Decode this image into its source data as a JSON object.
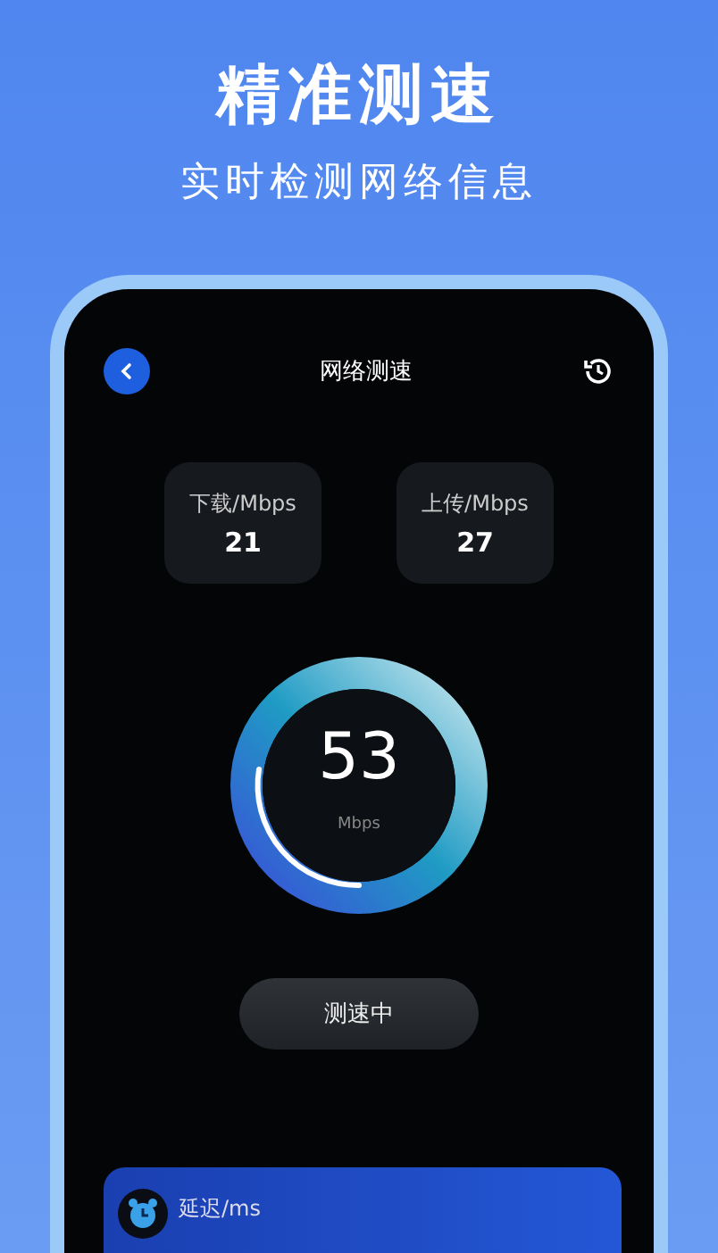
{
  "banner": {
    "title": "精准测速",
    "subtitle": "实时检测网络信息"
  },
  "screen": {
    "title": "网络测速",
    "stats": [
      {
        "label": "下载/Mbps",
        "value": "21"
      },
      {
        "label": "上传/Mbps",
        "value": "27"
      }
    ],
    "gauge": {
      "value": "53",
      "unit": "Mbps"
    },
    "action": "测速中",
    "latency_label": "延迟/ms"
  }
}
